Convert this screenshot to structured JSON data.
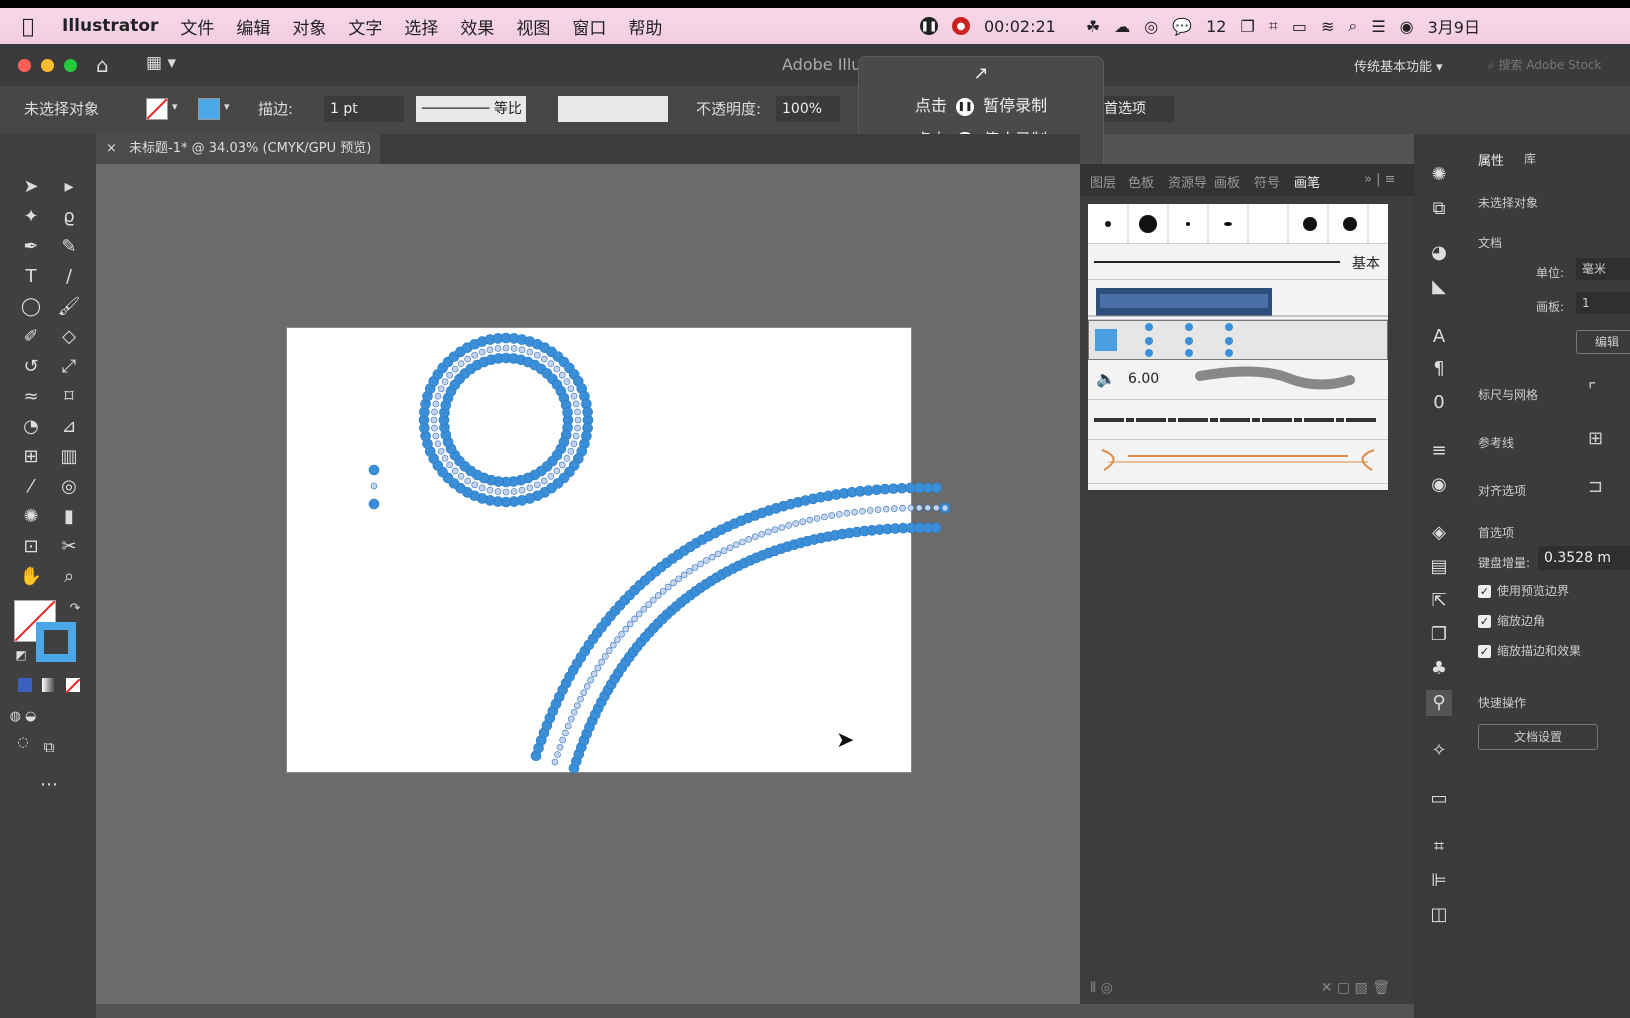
{
  "menubar": {
    "app": "Illustrator",
    "items": [
      "文件",
      "编辑",
      "对象",
      "文字",
      "选择",
      "效果",
      "视图",
      "窗口",
      "帮助"
    ],
    "timer": "00:02:21",
    "wechat_count": "12",
    "date": "3月9日"
  },
  "titlebar": {
    "title": "Adobe Illu",
    "workspace": "传统基本功能",
    "search_placeholder": "搜索 Adobe Stock"
  },
  "ctrlbar": {
    "no_selection": "未选择对象",
    "stroke_label": "描边:",
    "stroke_value": "1 pt",
    "profile": "等比",
    "opacity_label": "不透明度:",
    "opacity_value": "100%",
    "prefs": "首选项"
  },
  "popup": {
    "pause_prefix": "点击",
    "pause": "暂停录制",
    "stop_prefix": "点击",
    "stop": "停止录制"
  },
  "doctab": {
    "title": "未标题-1* @ 34.03% (CMYK/GPU 预览)"
  },
  "brush_panel": {
    "tabs": [
      "图层",
      "色板",
      "资源导",
      "画板",
      "符号",
      "画笔"
    ],
    "basic_label": "基本",
    "size_label": "6.00"
  },
  "props": {
    "tab_props": "属性",
    "tab_lib": "库",
    "no_selection": "未选择对象",
    "doc": "文档",
    "unit_label": "单位:",
    "unit_value": "毫米",
    "artboard_label": "画板:",
    "artboard_value": "1",
    "edit_btn": "编辑",
    "rulers": "标尺与网格",
    "guides": "参考线",
    "align": "对齐选项",
    "prefs": "首选项",
    "key_inc_label": "键盘增量:",
    "key_inc_value": "0.3528 m",
    "chk1": "使用预览边界",
    "chk2": "缩放边角",
    "chk3": "缩放描边和效果",
    "quick": "快速操作",
    "doc_setup": "文档设置"
  },
  "colors": {
    "accent": "#4a9fe0",
    "dot": "#3a8fd8"
  }
}
